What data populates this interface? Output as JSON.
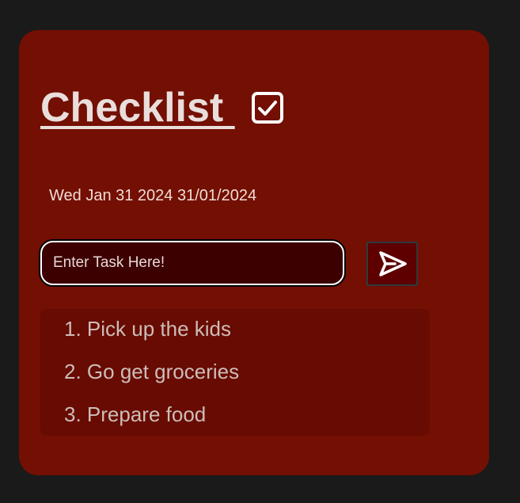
{
  "app": {
    "title": "Checklist "
  },
  "date": {
    "text": "Wed Jan 31 2024 31/01/2024"
  },
  "input": {
    "value": "",
    "placeholder": "Enter Task Here!"
  },
  "send_button": {
    "icon": "send-icon"
  },
  "tasks": [
    {
      "label": "1. Pick up the kids"
    },
    {
      "label": "2. Go get groceries"
    },
    {
      "label": "3. Prepare food"
    }
  ],
  "colors": {
    "background": "#1a1a1a",
    "card": "#730f03",
    "list_background": "#680b02",
    "input_background": "#3c0000",
    "button_background": "#5e0000",
    "title_text": "#e9dedc",
    "task_text": "#cdbdb8"
  }
}
